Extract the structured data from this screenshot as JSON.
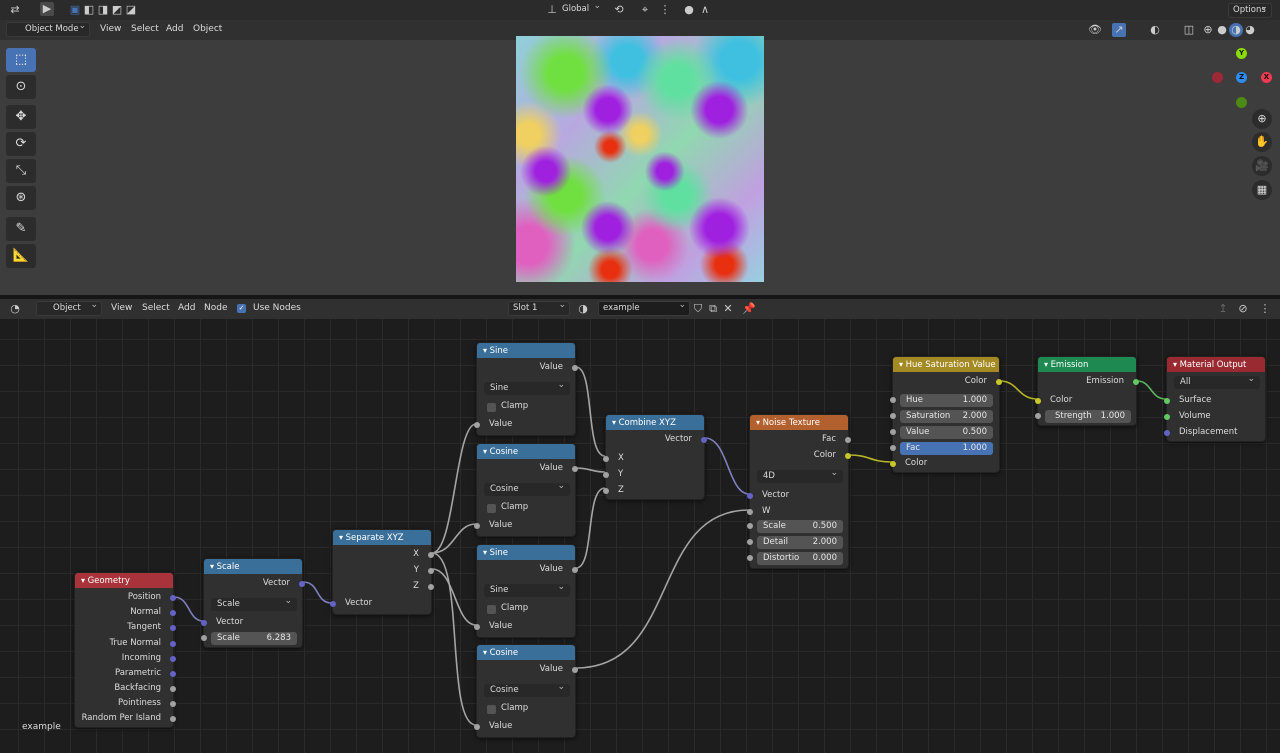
{
  "top_bar": {
    "transform_orientation": "Global",
    "options_label": "Options"
  },
  "viewport_header": {
    "mode": "Object Mode",
    "menus": [
      "View",
      "Select",
      "Add",
      "Object"
    ]
  },
  "gizmo": {
    "x": "X",
    "y": "Y",
    "z": "Z"
  },
  "node_header": {
    "type": "Object",
    "menus": [
      "View",
      "Select",
      "Add",
      "Node"
    ],
    "use_nodes_label": "Use Nodes",
    "slot": "Slot 1",
    "material_name": "example"
  },
  "material_label": "example",
  "nodes": {
    "geometry": {
      "title": "Geometry",
      "outputs": [
        "Position",
        "Normal",
        "Tangent",
        "True Normal",
        "Incoming",
        "Parametric",
        "Backfacing",
        "Pointiness",
        "Random Per Island"
      ]
    },
    "scale": {
      "title": "Scale",
      "output": "Vector",
      "operation": "Scale",
      "input": "Vector",
      "field_label": "Scale",
      "field_value": "6.283"
    },
    "separate": {
      "title": "Separate XYZ",
      "outputs": [
        "X",
        "Y",
        "Z"
      ],
      "input": "Vector"
    },
    "sine1": {
      "title": "Sine",
      "output": "Value",
      "operation": "Sine",
      "clamp": "Clamp",
      "input": "Value"
    },
    "cosine1": {
      "title": "Cosine",
      "output": "Value",
      "operation": "Cosine",
      "clamp": "Clamp",
      "input": "Value"
    },
    "sine2": {
      "title": "Sine",
      "output": "Value",
      "operation": "Sine",
      "clamp": "Clamp",
      "input": "Value"
    },
    "cosine2": {
      "title": "Cosine",
      "output": "Value",
      "operation": "Cosine",
      "clamp": "Clamp",
      "input": "Value"
    },
    "combine": {
      "title": "Combine XYZ",
      "output": "Vector",
      "inputs": [
        "X",
        "Y",
        "Z"
      ]
    },
    "noise": {
      "title": "Noise Texture",
      "outputs": [
        "Fac",
        "Color"
      ],
      "dimensions": "4D",
      "inputs": [
        "Vector",
        "W"
      ],
      "fields": [
        {
          "label": "Scale",
          "value": "0.500"
        },
        {
          "label": "Detail",
          "value": "2.000"
        },
        {
          "label": "Distortio",
          "value": "0.000"
        }
      ]
    },
    "hsv": {
      "title": "Hue Saturation Value",
      "output": "Color",
      "fields": [
        {
          "label": "Hue",
          "value": "1.000"
        },
        {
          "label": "Saturation",
          "value": "2.000"
        },
        {
          "label": "Value",
          "value": "0.500"
        },
        {
          "label": "Fac",
          "value": "1.000"
        }
      ],
      "input": "Color"
    },
    "emission": {
      "title": "Emission",
      "output": "Emission",
      "input": "Color",
      "field_label": "Strength",
      "field_value": "1.000"
    },
    "output": {
      "title": "Material Output",
      "target": "All",
      "inputs": [
        "Surface",
        "Volume",
        "Displacement"
      ]
    }
  },
  "colors": {
    "accent": "#4772b3",
    "vector_socket": "#6363c7",
    "color_socket": "#c7c729",
    "float_socket": "#a1a1a1",
    "shader_socket": "#63c763"
  }
}
